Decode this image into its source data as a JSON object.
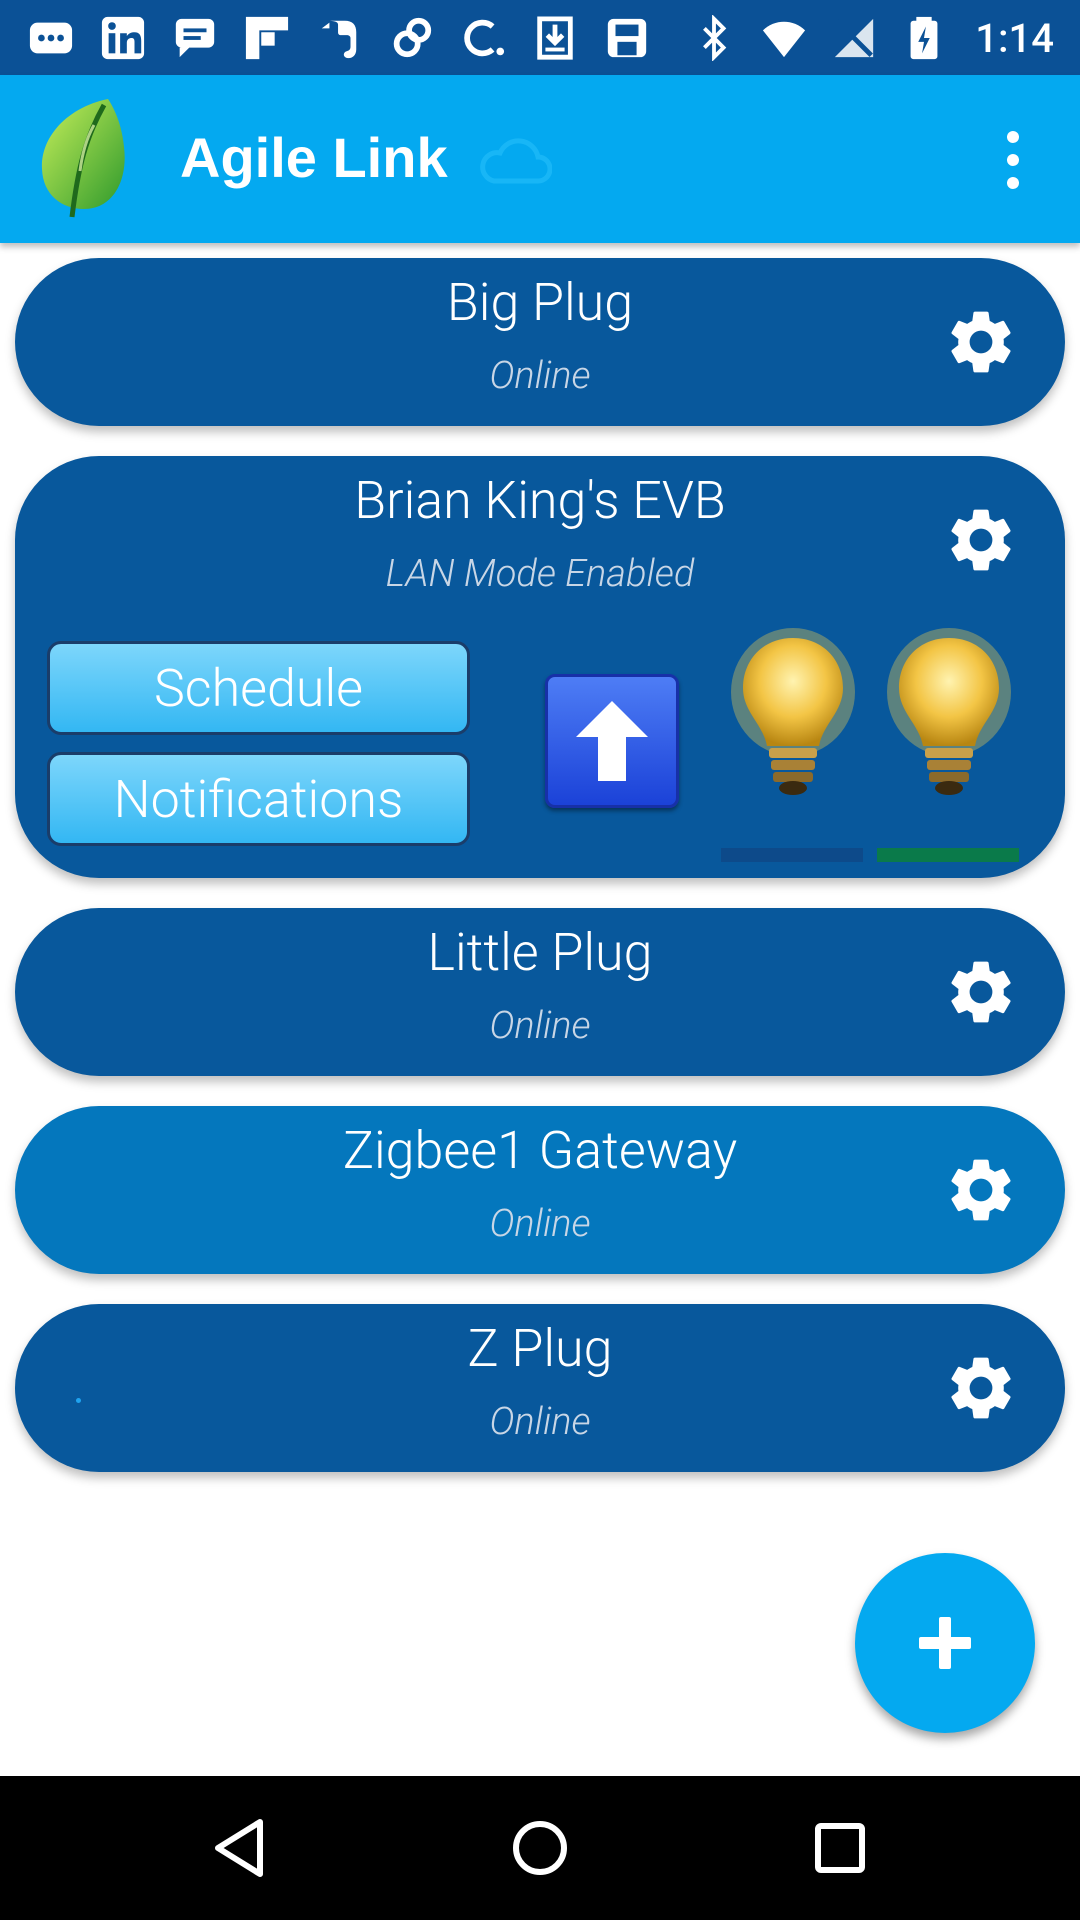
{
  "status_bar": {
    "time": "1:14",
    "left_icons": [
      "messaging-icon",
      "linkedin-icon",
      "chat-icon",
      "flipboard-icon",
      "evernote-icon",
      "link-icon",
      "c-app-icon",
      "download-icon",
      "save-icon"
    ],
    "right_icons": [
      "bluetooth-icon",
      "wifi-icon",
      "no-signal-icon",
      "battery-charging-icon"
    ]
  },
  "app_bar": {
    "title": "Agile Link"
  },
  "devices": [
    {
      "name": "Big Plug",
      "status": "Online"
    },
    {
      "name": "Brian King's EVB",
      "status": "LAN Mode Enabled",
      "schedule_label": "Schedule",
      "notifications_label": "Notifications"
    },
    {
      "name": "Little Plug",
      "status": "Online"
    },
    {
      "name": "Zigbee1 Gateway",
      "status": "Online"
    },
    {
      "name": "Z Plug",
      "status": "Online"
    }
  ],
  "colors": {
    "status_bar": "#0b5196",
    "app_bar": "#04a9f0",
    "card_dark": "#08589c",
    "card_mid": "#0477bd",
    "bulb1_bar": "#0d4a8a",
    "bulb2_bar": "#0a7a4a"
  }
}
